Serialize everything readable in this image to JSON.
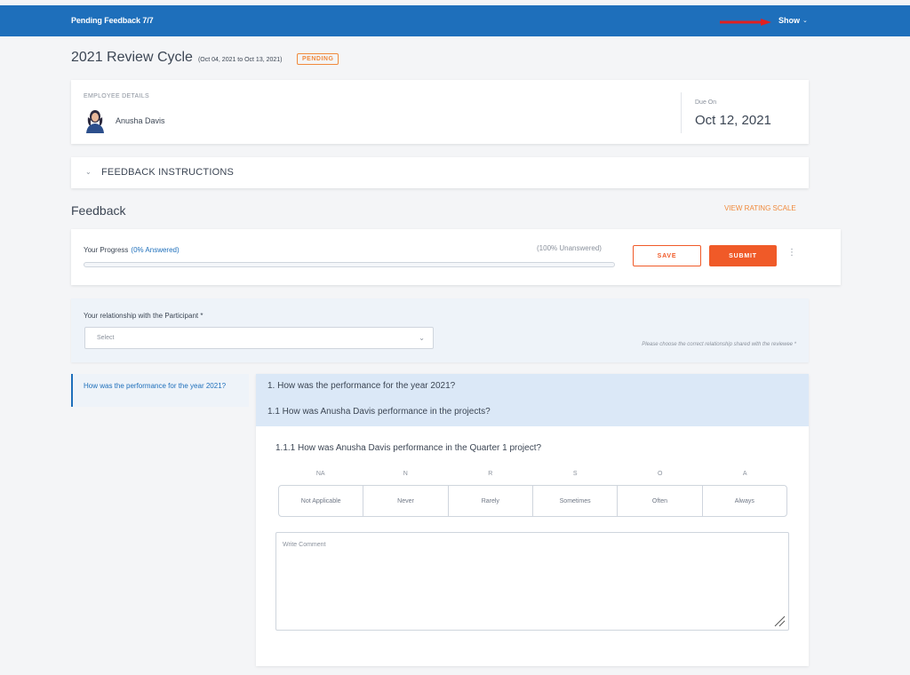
{
  "topbar": {
    "title": "Pending Feedback 7/7",
    "show_label": "Show",
    "chevron": "chevron-down-icon",
    "bar_color": "#1e6fbb"
  },
  "cycle": {
    "title": "2021 Review Cycle",
    "range": "(Oct 04, 2021 to Oct 13, 2021)",
    "status": "PENDING"
  },
  "employee": {
    "section_label": "EMPLOYEE DETAILS",
    "name": "Anusha Davis",
    "avatar": "person-avatar-icon",
    "due_label": "Due On",
    "due_date": "Oct 12, 2021"
  },
  "instructions": {
    "label": "FEEDBACK INSTRUCTIONS"
  },
  "feedback": {
    "title": "Feedback",
    "rating_scale_link": "VIEW RATING SCALE"
  },
  "progress": {
    "label": "Your Progress",
    "answered": "(0% Answered)",
    "unanswered": "(100% Unanswered)",
    "answered_fraction": 0,
    "save_label": "SAVE",
    "submit_label": "SUBMIT",
    "accent_color": "#f05a28"
  },
  "relationship": {
    "label": "Your relationship with the Participant *",
    "placeholder": "Select",
    "hint": "Please choose the correct relationship shared with the reviewee *"
  },
  "sidebar": {
    "items": [
      {
        "label": "How was the performance for the year 2021?"
      }
    ]
  },
  "question": {
    "heading": "1. How was the performance for the year 2021?",
    "subheading": "1.1 How was Anusha Davis performance in the projects?",
    "item": "1.1.1 How was Anusha Davis performance in the Quarter 1 project?",
    "scale": [
      {
        "code": "NA",
        "label": "Not Applicable"
      },
      {
        "code": "N",
        "label": "Never"
      },
      {
        "code": "R",
        "label": "Rarely"
      },
      {
        "code": "S",
        "label": "Sometimes"
      },
      {
        "code": "O",
        "label": "Often"
      },
      {
        "code": "A",
        "label": "Always"
      }
    ],
    "comment_placeholder": "Write Comment"
  }
}
